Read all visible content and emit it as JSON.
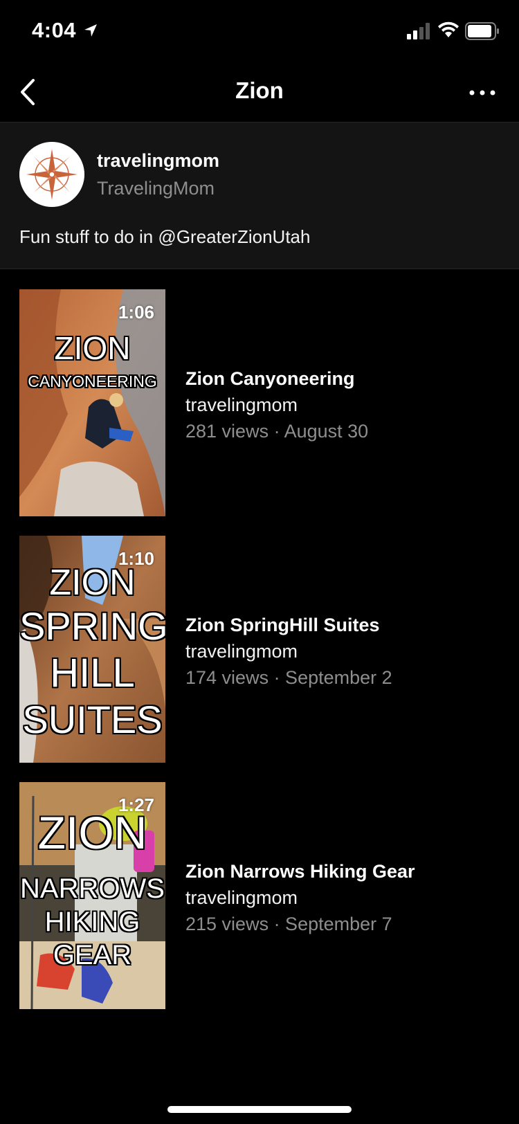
{
  "status_bar": {
    "time": "4:04"
  },
  "nav": {
    "title": "Zion"
  },
  "profile": {
    "username": "travelingmom",
    "display_name": "TravelingMom",
    "description": "Fun stuff to do in @GreaterZionUtah"
  },
  "videos": [
    {
      "duration": "1:06",
      "thumb_lines": [
        "ZION",
        "CANYONEERING"
      ],
      "title": "Zion Canyoneering",
      "channel": "travelingmom",
      "meta": "281 views · August 30"
    },
    {
      "duration": "1:10",
      "thumb_lines": [
        "ZION",
        "SPRING",
        "HILL",
        "SUITES"
      ],
      "title": "Zion SpringHill Suites",
      "channel": "travelingmom",
      "meta": "174 views · September 2"
    },
    {
      "duration": "1:27",
      "thumb_lines": [
        "ZION",
        "NARROWS",
        "HIKING",
        "GEAR"
      ],
      "title": "Zion Narrows Hiking Gear",
      "channel": "travelingmom",
      "meta": "215 views · September 7"
    }
  ],
  "colors": {
    "background": "#000000",
    "card": "#141414",
    "secondary_text": "#8e8e8e"
  }
}
